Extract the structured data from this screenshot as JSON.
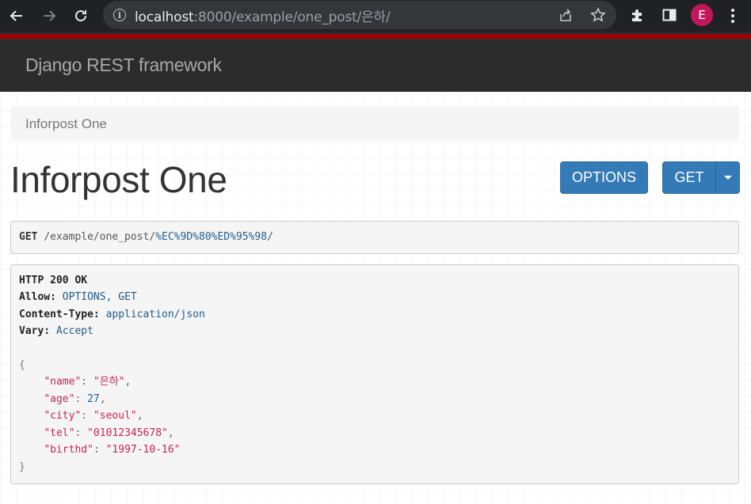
{
  "browser": {
    "url_host": "localhost",
    "url_rest": ":8000/example/one_post/은하/",
    "avatar_letter": "E"
  },
  "navbar": {
    "brand": "Django REST framework"
  },
  "breadcrumb": {
    "item": "Inforpost One"
  },
  "page": {
    "title": "Inforpost One"
  },
  "buttons": {
    "options": "OPTIONS",
    "get": "GET"
  },
  "request": {
    "method": "GET",
    "path_prefix": "/example/one_post/",
    "path_encoded": "%EC%9D%80%ED%95%98",
    "path_suffix": "/"
  },
  "response": {
    "status": "HTTP 200 OK",
    "headers": [
      {
        "key": "Allow:",
        "value": "OPTIONS, GET"
      },
      {
        "key": "Content-Type:",
        "value": "application/json"
      },
      {
        "key": "Vary:",
        "value": "Accept"
      }
    ],
    "body": {
      "open": "{",
      "close": "}",
      "fields": [
        {
          "key": "\"name\"",
          "value": "\"은하\"",
          "type": "str",
          "comma": ","
        },
        {
          "key": "\"age\"",
          "value": "27",
          "type": "num",
          "comma": ","
        },
        {
          "key": "\"city\"",
          "value": "\"seoul\"",
          "type": "str",
          "comma": ","
        },
        {
          "key": "\"tel\"",
          "value": "\"01012345678\"",
          "type": "str",
          "comma": ","
        },
        {
          "key": "\"birthd\"",
          "value": "\"1997-10-16\"",
          "type": "str",
          "comma": ""
        }
      ]
    }
  },
  "colors": {
    "navbar_bg": "#2c2c2c",
    "accent_red": "#a30000",
    "button_blue": "#337ab7",
    "json_string": "#c7254e"
  },
  "icons": {
    "back": "arrow-left-icon",
    "forward": "arrow-right-icon",
    "reload": "reload-icon",
    "site_info": "info-icon",
    "share": "share-icon",
    "bookmark": "star-icon",
    "extensions": "puzzle-icon",
    "side_panel": "side-panel-icon",
    "menu": "kebab-menu-icon"
  }
}
